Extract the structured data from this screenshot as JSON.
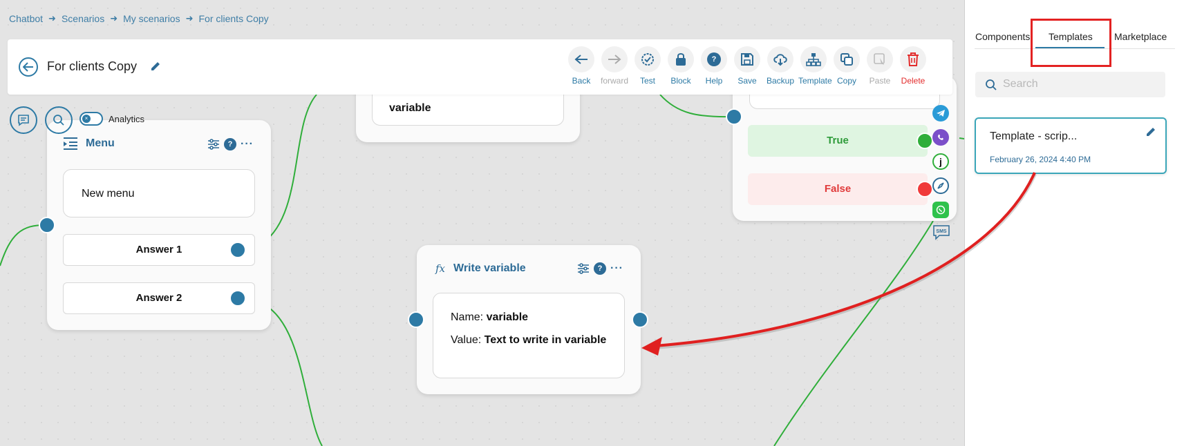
{
  "breadcrumb": [
    "Chatbot",
    "Scenarios",
    "My scenarios",
    "For clients Copy"
  ],
  "header": {
    "title": "For clients Copy"
  },
  "toolbar": {
    "back": "Back",
    "forward": "forward",
    "test": "Test",
    "block": "Block",
    "help": "Help",
    "save": "Save",
    "backup": "Backup",
    "template": "Template",
    "copy": "Copy",
    "paste": "Paste",
    "delete": "Delete"
  },
  "canvas_controls": {
    "analytics_label": "Analytics",
    "toggle_icon": "×"
  },
  "nodes": {
    "top_partial": {
      "text": "variable"
    },
    "menu": {
      "title": "Menu",
      "message": "New menu",
      "answers": [
        "Answer 1",
        "Answer 2"
      ]
    },
    "write_variable": {
      "icon": "fx",
      "title": "Write variable",
      "name_label": "Name:",
      "name_value": "variable",
      "value_label": "Value:",
      "value_value": "Text to write in variable"
    },
    "condition": {
      "true_label": "True",
      "false_label": "False"
    }
  },
  "channels": {
    "j": "j",
    "sms": "SMS"
  },
  "panel": {
    "tabs": [
      "Components",
      "Templates",
      "Marketplace"
    ],
    "active_tab": "Templates",
    "search_placeholder": "Search",
    "template_card": {
      "name": "Template - scrip...",
      "date": "February 26, 2024 4:40 PM"
    }
  },
  "colors": {
    "accent": "#2d7aa5",
    "highlight": "#e32222",
    "true_bg": "#dff5e1",
    "false_bg": "#fdecec",
    "wire": "#2fae3a"
  }
}
